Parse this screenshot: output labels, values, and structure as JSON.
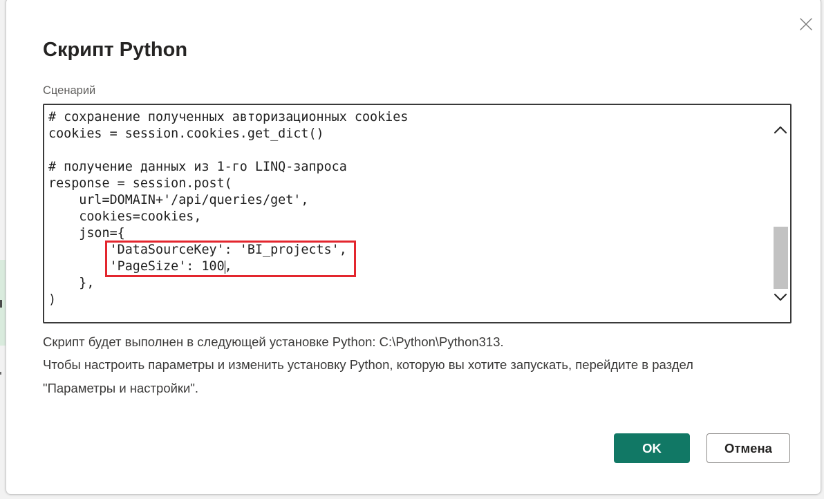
{
  "dialog": {
    "title": "Скрипт Python"
  },
  "editor": {
    "label": "Сценарий",
    "lines": [
      "# сохранение полученных авторизационных cookies",
      "cookies = session.cookies.get_dict()",
      "",
      "# получение данных из 1-го LINQ-запроса",
      "response = session.post(",
      "    url=DOMAIN+'/api/queries/get',",
      "    cookies=cookies,",
      "    json={",
      "        'DataSourceKey': 'BI_projects',",
      "        'PageSize': 100,",
      "    },",
      ")"
    ],
    "scrollbar": {
      "scroll_percent": 100
    }
  },
  "info": {
    "python_install": "Скрипт будет выполнен в следующей установке Python: C:\\Python\\Python313.",
    "settings_hint": [
      "Чтобы настроить параметры и изменить установку Python, которую вы хотите запускать, перейдите в раздел",
      "\"Параметры и настройки\"."
    ]
  },
  "buttons": {
    "ok": "OK",
    "cancel": "Отмена"
  },
  "icons": {
    "close": "close-icon",
    "scroll_up": "chevron-up-icon",
    "scroll_down": "chevron-down-icon"
  },
  "colors": {
    "primary_button": "#117865",
    "highlight_box": "#e3262e",
    "scrollbar_thumb": "#c2c2c2"
  }
}
